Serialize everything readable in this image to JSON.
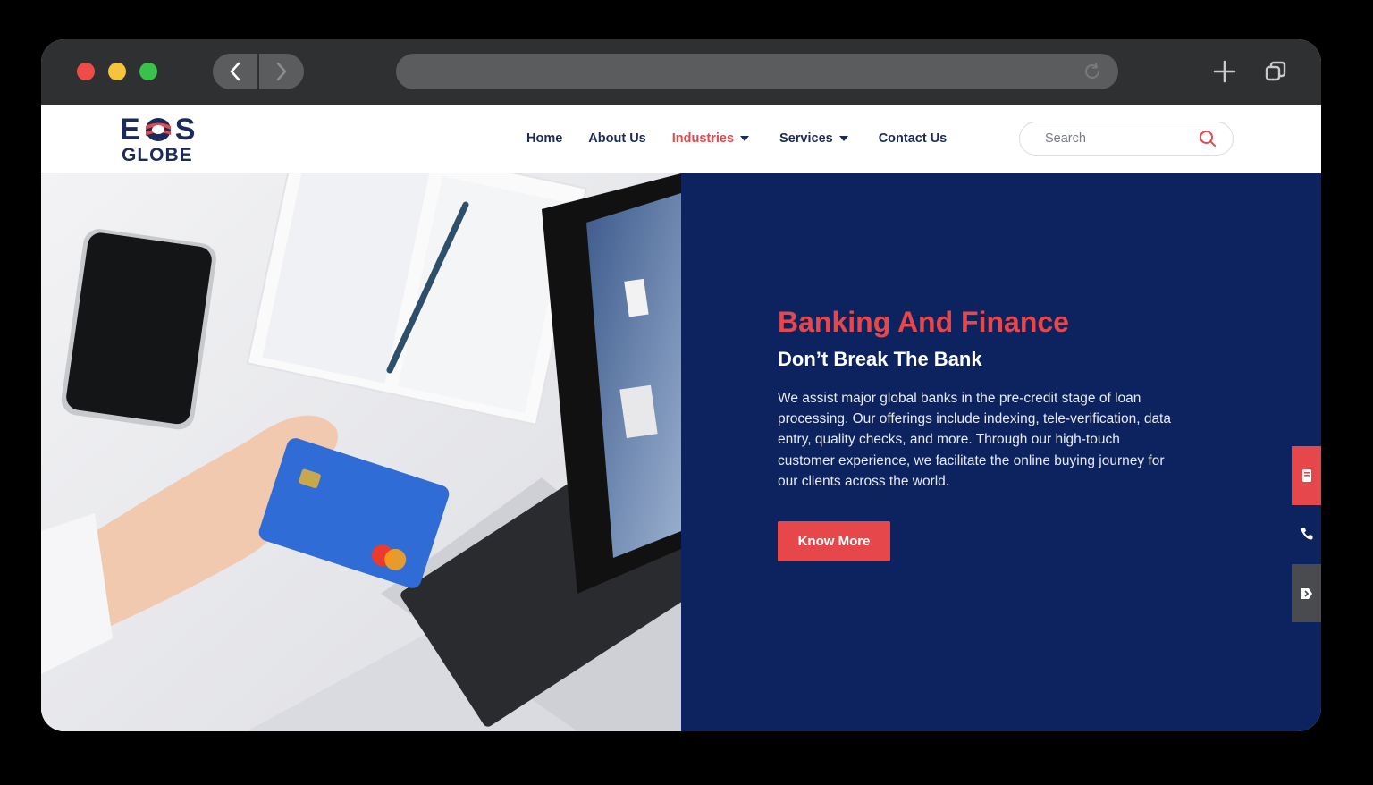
{
  "browser": {
    "back_icon": "chevron-left-icon",
    "forward_icon": "chevron-right-icon",
    "reload_icon": "reload-icon",
    "new_tab_icon": "plus-icon",
    "tabs_icon": "tabs-icon",
    "traffic_lights": [
      "#ee4b4b",
      "#f6c43b",
      "#38c24a"
    ]
  },
  "header": {
    "logo_top": "EOS",
    "logo_top_left": "E",
    "logo_top_right": "S",
    "logo_bottom": "GLOBE",
    "nav": [
      {
        "label": "Home",
        "dropdown": false,
        "active": false
      },
      {
        "label": "About Us",
        "dropdown": false,
        "active": false
      },
      {
        "label": "Industries",
        "dropdown": true,
        "active": true
      },
      {
        "label": "Services",
        "dropdown": true,
        "active": false
      },
      {
        "label": "Contact Us",
        "dropdown": false,
        "active": false
      }
    ],
    "search": {
      "placeholder": "Search",
      "icon": "search-icon"
    }
  },
  "hero": {
    "title": "Banking And Finance",
    "subtitle": "Don’t Break The Bank",
    "text": "We assist major global banks in the pre-credit stage of loan processing. Our offerings include indexing, tele-verification, data entry, quality checks, and more. Through our high-touch customer experience, we facilitate the online buying journey for our clients across the world.",
    "button": "Know More",
    "image": "person holding credit card next to laptop keyboard and phone"
  },
  "side_buttons": [
    {
      "icon": "book-icon",
      "color": "#e5474b"
    },
    {
      "icon": "phone-icon",
      "color": "#0d2360"
    },
    {
      "icon": "exit-icon",
      "color": "#4a4b4e"
    }
  ],
  "colors": {
    "brand_navy": "#0d2360",
    "accent_red": "#e5474b",
    "nav_text": "#1c2a5a"
  }
}
